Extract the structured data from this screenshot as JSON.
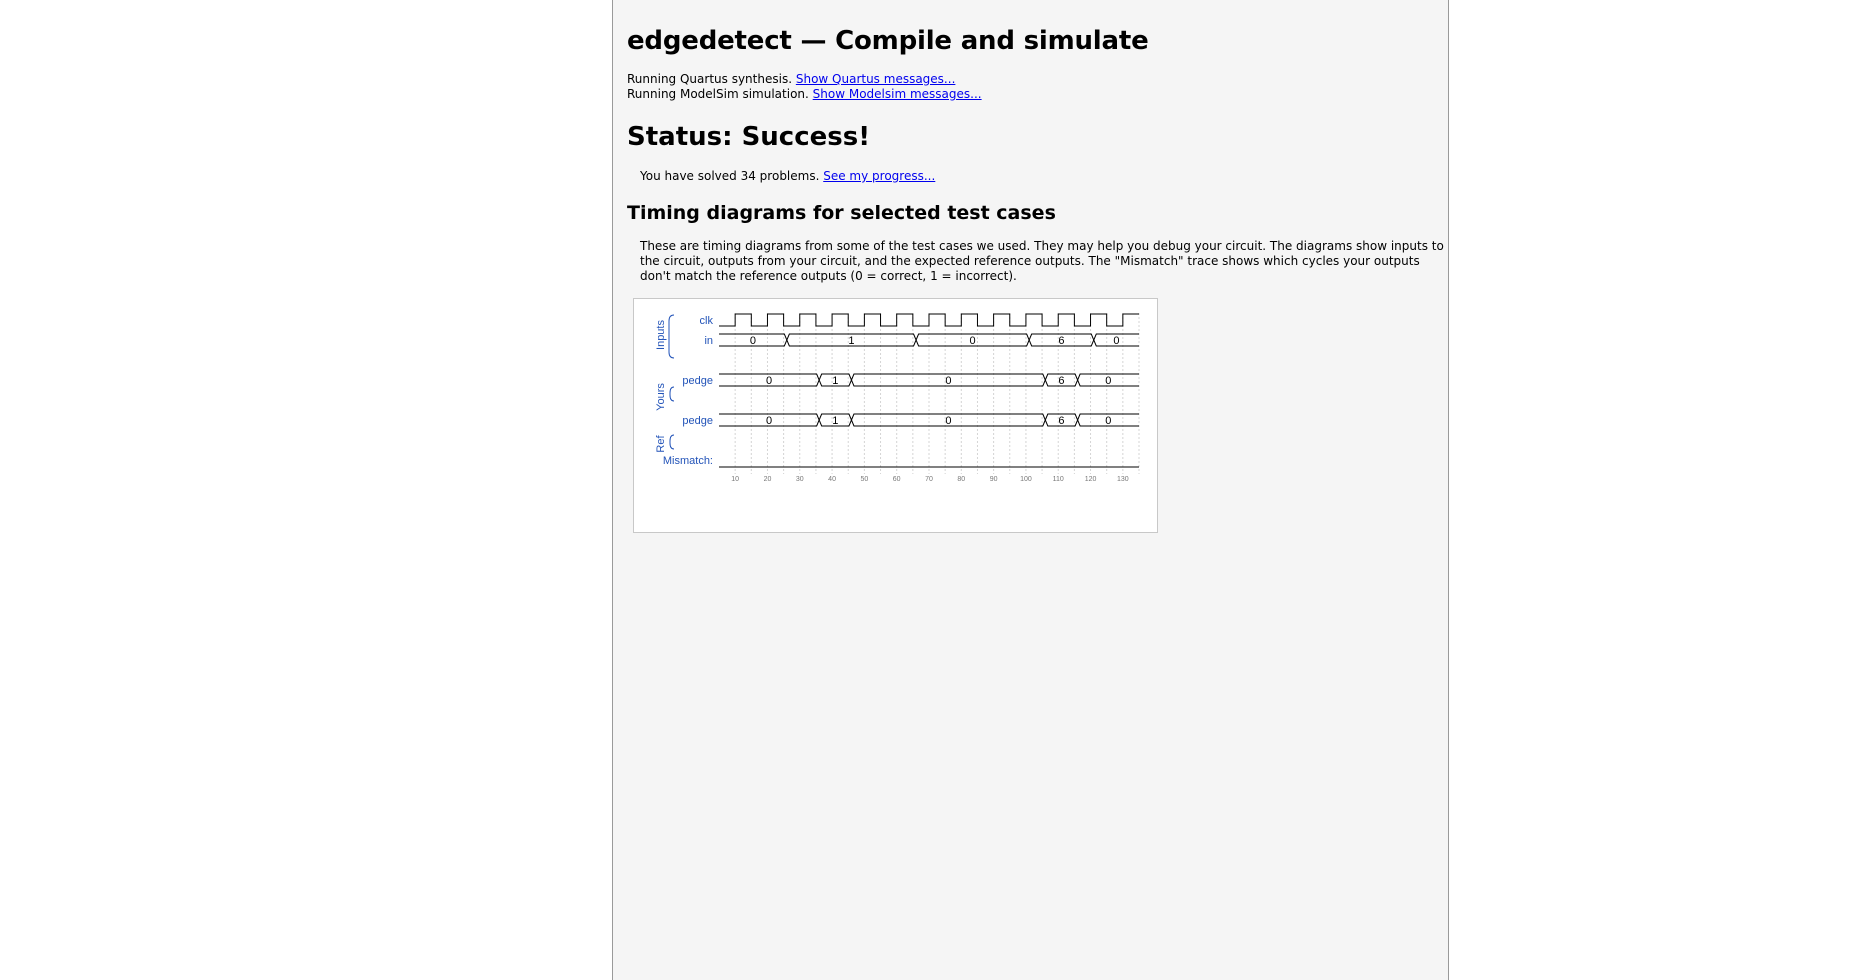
{
  "page": {
    "title": "edgedetect — Compile and simulate",
    "quartus_text": "Running Quartus synthesis.",
    "quartus_link": "Show Quartus messages...",
    "modelsim_text": "Running ModelSim simulation.",
    "modelsim_link": "Show Modelsim messages...",
    "status": "Status: Success!",
    "solved_text": "You have solved 34 problems.",
    "progress_link": "See my progress...",
    "timing_heading": "Timing diagrams for selected test cases",
    "timing_desc": "These are timing diagrams from some of the test cases we used. They may help you debug your circuit. The diagrams show inputs to the circuit, outputs from your circuit, and the expected reference outputs. The \"Mismatch\" trace shows which cycles your outputs don't match the reference outputs (0 = correct, 1 = incorrect)."
  },
  "waveform": {
    "groups": {
      "inputs": "Inputs",
      "yours": "Yours",
      "ref": "Ref"
    },
    "signal_names": {
      "clk": "clk",
      "in": "in",
      "pedge_yours": "pedge",
      "pedge_ref": "pedge",
      "mismatch": "Mismatch:"
    },
    "time_range": [
      5,
      135
    ],
    "clock": {
      "first_rise": 10,
      "period": 10
    },
    "buses": {
      "in": [
        {
          "start": 5,
          "end": 26,
          "value": "0"
        },
        {
          "start": 26,
          "end": 66,
          "value": "1"
        },
        {
          "start": 66,
          "end": 101,
          "value": "0"
        },
        {
          "start": 101,
          "end": 121,
          "value": "6"
        },
        {
          "start": 121,
          "end": 135,
          "value": "0"
        }
      ],
      "pedge_yours": [
        {
          "start": 5,
          "end": 36,
          "value": "0"
        },
        {
          "start": 36,
          "end": 46,
          "value": "1"
        },
        {
          "start": 46,
          "end": 106,
          "value": "0"
        },
        {
          "start": 106,
          "end": 116,
          "value": "6"
        },
        {
          "start": 116,
          "end": 135,
          "value": "0"
        }
      ],
      "pedge_ref": [
        {
          "start": 5,
          "end": 36,
          "value": "0"
        },
        {
          "start": 36,
          "end": 46,
          "value": "1"
        },
        {
          "start": 46,
          "end": 106,
          "value": "0"
        },
        {
          "start": 106,
          "end": 116,
          "value": "6"
        },
        {
          "start": 116,
          "end": 135,
          "value": "0"
        }
      ]
    },
    "mismatch_level": 0,
    "time_ticks": [
      "10",
      "20",
      "30",
      "40",
      "50",
      "60",
      "70",
      "80",
      "90",
      "100",
      "110",
      "120",
      "130"
    ]
  }
}
